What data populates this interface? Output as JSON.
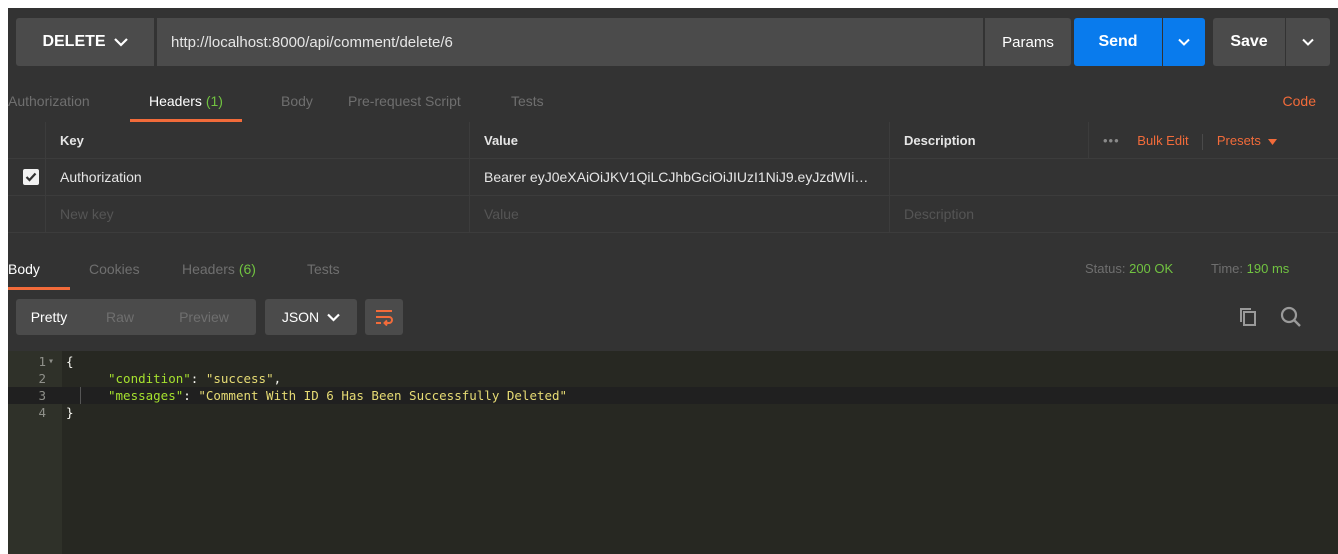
{
  "request": {
    "method": "DELETE",
    "url": "http://localhost:8000/api/comment/delete/6",
    "params_label": "Params",
    "send_label": "Send",
    "save_label": "Save"
  },
  "request_tabs": {
    "authorization": "Authorization",
    "headers": "Headers",
    "headers_count": "(1)",
    "body": "Body",
    "prerequest": "Pre-request Script",
    "tests": "Tests",
    "code": "Code"
  },
  "headers_table": {
    "col_key": "Key",
    "col_value": "Value",
    "col_description": "Description",
    "more": "•••",
    "bulk_edit": "Bulk Edit",
    "presets": "Presets",
    "rows": [
      {
        "key": "Authorization",
        "value": "Bearer eyJ0eXAiOiJKV1QiLCJhbGciOiJIUzI1NiJ9.eyJzdWIi…",
        "description": ""
      }
    ],
    "new_row": {
      "key": "New key",
      "value": "Value",
      "description": "Description"
    }
  },
  "response_tabs": {
    "body": "Body",
    "cookies": "Cookies",
    "headers": "Headers",
    "headers_count": "(6)",
    "tests": "Tests",
    "status_label": "Status:",
    "status_value": "200 OK",
    "time_label": "Time:",
    "time_value": "190 ms"
  },
  "response_toolbar": {
    "pretty": "Pretty",
    "raw": "Raw",
    "preview": "Preview",
    "format": "JSON"
  },
  "response_body": {
    "lines": [
      {
        "n": "1",
        "open": "{"
      },
      {
        "n": "2",
        "key": "\"condition\"",
        "value": "\"success\"",
        "sep": ": ",
        "end": ","
      },
      {
        "n": "3",
        "key": "\"messages\"",
        "value": "\"Comment With ID 6 Has Been Successfully Deleted\"",
        "sep": ": ",
        "end": ""
      },
      {
        "n": "4",
        "close": "}"
      }
    ]
  },
  "colors": {
    "accent": "#f26b3a",
    "primary": "#097bed",
    "success": "#71c341",
    "background": "#333333"
  }
}
